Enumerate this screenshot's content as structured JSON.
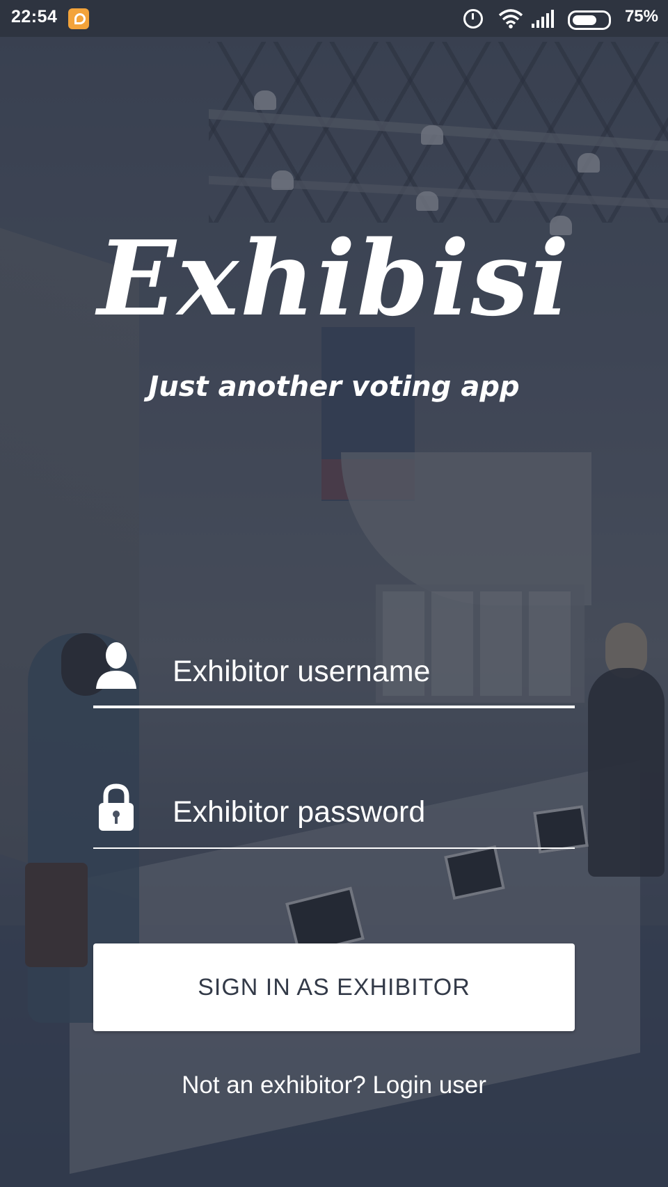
{
  "status_bar": {
    "time": "22:54",
    "notification_icon": "orange-app-notification-icon",
    "icons": [
      "alarm-icon",
      "wifi-icon",
      "signal-icon",
      "battery-icon"
    ],
    "battery_level": 0.75,
    "battery_text": "75%"
  },
  "app": {
    "logo_text": "Exhibisi",
    "tagline": "Just another voting app"
  },
  "login_form": {
    "username": {
      "icon": "user-icon",
      "placeholder": "Exhibitor username",
      "value": ""
    },
    "password": {
      "icon": "lock-icon",
      "placeholder": "Exhibitor password",
      "value": ""
    },
    "submit_label": "SIGN IN AS EXHIBITOR",
    "alt_prompt": "Not an exhibitor?",
    "alt_link": "Login user"
  },
  "colors": {
    "overlay": "#283040",
    "status_bar": "#2e3440",
    "button_text": "#333a48",
    "notification": "#f3a33a"
  }
}
